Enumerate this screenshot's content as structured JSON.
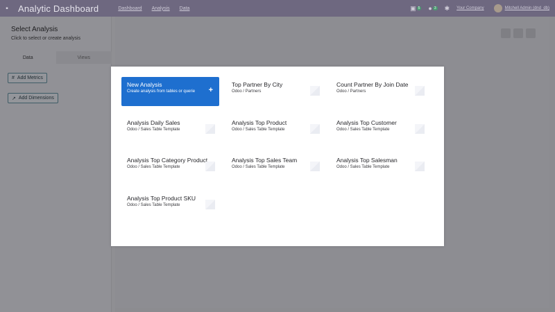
{
  "navbar": {
    "title": "Analytic Dashboard",
    "links": [
      "Dashboard",
      "Analysis",
      "Data"
    ],
    "badges": [
      "5",
      "3"
    ],
    "company": "Your Company",
    "user": "Mitchell Admin (dnd_db)"
  },
  "sidebar": {
    "title": "Select Analysis",
    "subtitle": "Click to select or create analysis",
    "tabs": [
      "Data",
      "Views"
    ],
    "add_metrics": "Add Metrics",
    "add_dimensions": "Add Dimensions"
  },
  "modal": {
    "new": {
      "title": "New Analysis",
      "sub": "Create analysis from tables or querie"
    },
    "cards": [
      {
        "title": "Top Partner By City",
        "sub": "Odoo / Partners"
      },
      {
        "title": "Count Partner By Join Date",
        "sub": "Odoo / Partners"
      },
      {
        "title": "Analysis Daily Sales",
        "sub": "Odoo / Sales Table Template"
      },
      {
        "title": "Analysis Top Product",
        "sub": "Odoo / Sales Table Template"
      },
      {
        "title": "Analysis Top Customer",
        "sub": "Odoo / Sales Table Template"
      },
      {
        "title": "Analysis Top Category Product",
        "sub": "Odoo / Sales Table Template"
      },
      {
        "title": "Analysis Top Sales Team",
        "sub": "Odoo / Sales Table Template"
      },
      {
        "title": "Analysis Top Salesman",
        "sub": "Odoo / Sales Table Template"
      },
      {
        "title": "Analysis Top Product SKU",
        "sub": "Odoo / Sales Table Template"
      }
    ]
  },
  "colors": {
    "primary": "#1e6fcf",
    "navbar": "#6e6880"
  }
}
